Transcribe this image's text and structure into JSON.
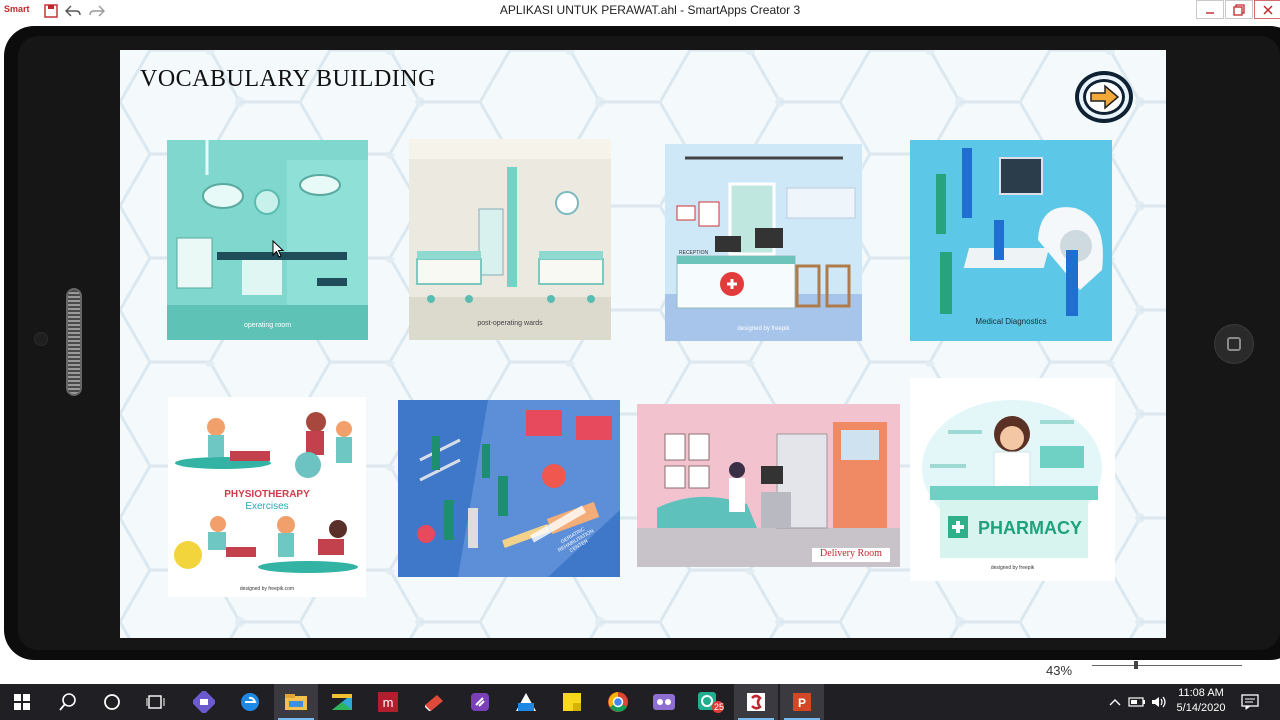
{
  "app": {
    "logo_text": "Smart",
    "window_title": "APLIKASI UNTUK PERAWAT.ahl - SmartApps Creator 3"
  },
  "slide": {
    "title": "VOCABULARY BUILDING",
    "cards": [
      {
        "caption": "operating room"
      },
      {
        "caption": "post-operating wards"
      },
      {
        "caption": "RECEPTION",
        "credit": "designed by freepik"
      },
      {
        "caption": "Medical Diagnostics"
      },
      {
        "caption": "PHYSIOTHERAPY",
        "caption2": "Exercises",
        "credit": "designed by freepik.com"
      },
      {
        "caption": "GERIATRIC REHABILITATION CENTER"
      },
      {
        "caption": "Delivery Room"
      },
      {
        "caption": "PHARMACY",
        "credit": "designed by freepik"
      }
    ]
  },
  "editor": {
    "zoom": "43%"
  },
  "taskbar": {
    "apps": [
      "start-icon",
      "search-icon",
      "cortana-icon",
      "task-view-icon",
      "visual-studio-icon",
      "edge-icon",
      "file-explorer-icon",
      "app-icon",
      "mendeley-icon",
      "app-icon",
      "app-icon",
      "app-icon",
      "sticky-notes-icon",
      "chrome-icon",
      "app-icon",
      "app-icon",
      "smartapps-icon",
      "powerpoint-icon"
    ],
    "notification_count": "25",
    "time": "11:08 AM",
    "date": "5/14/2020"
  },
  "colors": {
    "accent": "#c0272d",
    "teal": "#6fd0c4",
    "taskbar": "#1f1f24"
  }
}
